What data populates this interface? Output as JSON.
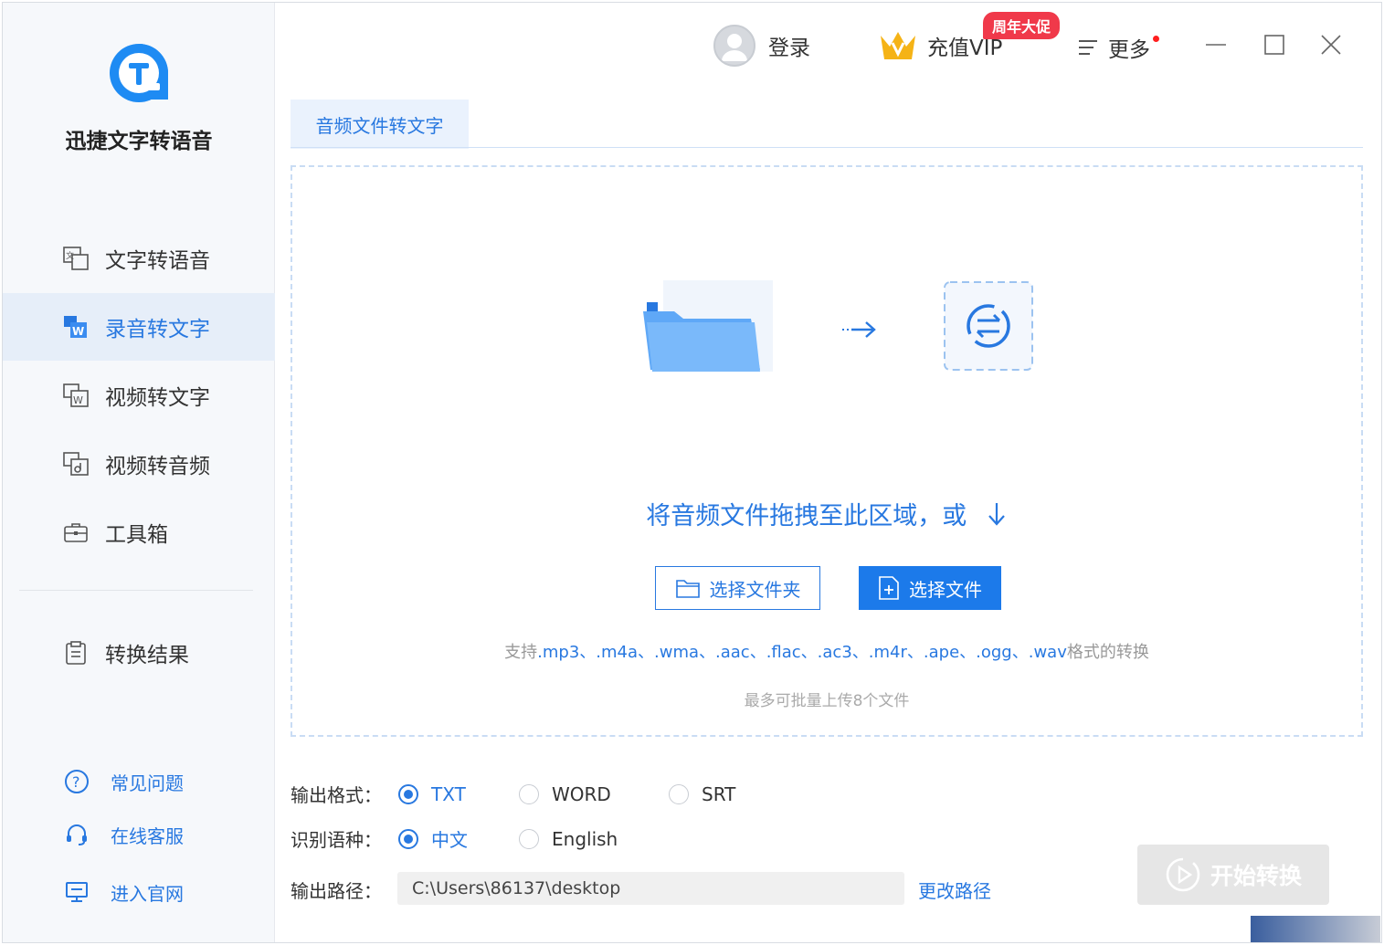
{
  "sidebar": {
    "app_name": "迅捷文字转语音",
    "nav": [
      {
        "label": "文字转语音",
        "icon": "text-to-speech-icon"
      },
      {
        "label": "录音转文字",
        "icon": "audio-to-word-icon",
        "active": true
      },
      {
        "label": "视频转文字",
        "icon": "video-to-word-icon"
      },
      {
        "label": "视频转音频",
        "icon": "video-to-audio-icon"
      },
      {
        "label": "工具箱",
        "icon": "toolbox-icon"
      },
      {
        "label": "转换结果",
        "icon": "clipboard-icon"
      }
    ],
    "help": [
      {
        "label": "常见问题",
        "icon": "question-icon"
      },
      {
        "label": "在线客服",
        "icon": "headset-icon"
      },
      {
        "label": "进入官网",
        "icon": "monitor-icon"
      }
    ]
  },
  "titlebar": {
    "login": "登录",
    "vip": "充值VIP",
    "promo_badge": "周年大促",
    "more": "更多"
  },
  "tab": {
    "label": "音频文件转文字"
  },
  "dropzone": {
    "prompt": "将音频文件拖拽至此区域，或",
    "select_folder": "选择文件夹",
    "select_file": "选择文件",
    "support_prefix": "支持",
    "formats": ".mp3、.m4a、.wma、.aac、.flac、.ac3、.m4r、.ape、.ogg、.wav",
    "support_suffix": "格式的转换",
    "max_note": "最多可批量上传8个文件"
  },
  "options": {
    "format_label": "输出格式：",
    "formats": [
      "TXT",
      "WORD",
      "SRT"
    ],
    "selected_format": "TXT",
    "lang_label": "识别语种：",
    "languages": [
      "中文",
      "English"
    ],
    "selected_language": "中文",
    "path_label": "输出路径：",
    "path_value": "C:\\Users\\86137\\desktop",
    "change_path": "更改路径"
  },
  "start_button": "开始转换",
  "colors": {
    "accent": "#2878e0",
    "primary_button": "#1c7aea",
    "promo": "#f0394a",
    "vip_gold": "#f5b316"
  }
}
